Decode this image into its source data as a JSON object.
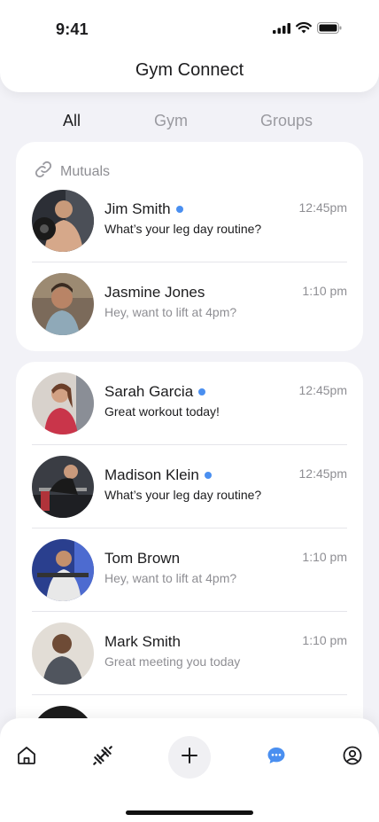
{
  "status_bar": {
    "time": "9:41"
  },
  "header": {
    "title": "Gym Connect"
  },
  "tabs": [
    {
      "label": "All",
      "active": true
    },
    {
      "label": "Gym",
      "active": false
    },
    {
      "label": "Groups",
      "active": false
    }
  ],
  "mutuals": {
    "label": "Mutuals",
    "icon": "link-icon",
    "items": [
      {
        "name": "Jim Smith",
        "online": true,
        "message": "What’s your leg day routine?",
        "time": "12:45pm",
        "unread": true
      },
      {
        "name": "Jasmine Jones",
        "online": false,
        "message": "Hey, want to lift at 4pm?",
        "time": "1:10 pm",
        "unread": false
      }
    ]
  },
  "conversations": [
    {
      "name": "Sarah Garcia",
      "online": true,
      "message": "Great workout today!",
      "time": "12:45pm",
      "unread": true
    },
    {
      "name": "Madison Klein",
      "online": true,
      "message": "What’s your leg day routine?",
      "time": "12:45pm",
      "unread": true
    },
    {
      "name": "Tom Brown",
      "online": false,
      "message": "Hey, want to lift at 4pm?",
      "time": "1:10 pm",
      "unread": false
    },
    {
      "name": "Mark Smith",
      "online": false,
      "message": "Great meeting you today",
      "time": "1:10 pm",
      "unread": false
    }
  ],
  "bottom_nav": [
    {
      "icon": "home-icon",
      "active": false
    },
    {
      "icon": "dumbbell-icon",
      "active": false
    },
    {
      "icon": "plus-icon",
      "active": false
    },
    {
      "icon": "chat-bubble-icon",
      "active": true
    },
    {
      "icon": "profile-icon",
      "active": false
    }
  ],
  "colors": {
    "accent": "#4a8ff0",
    "background": "#f2f2f7",
    "muted_text": "#8e8e93"
  }
}
